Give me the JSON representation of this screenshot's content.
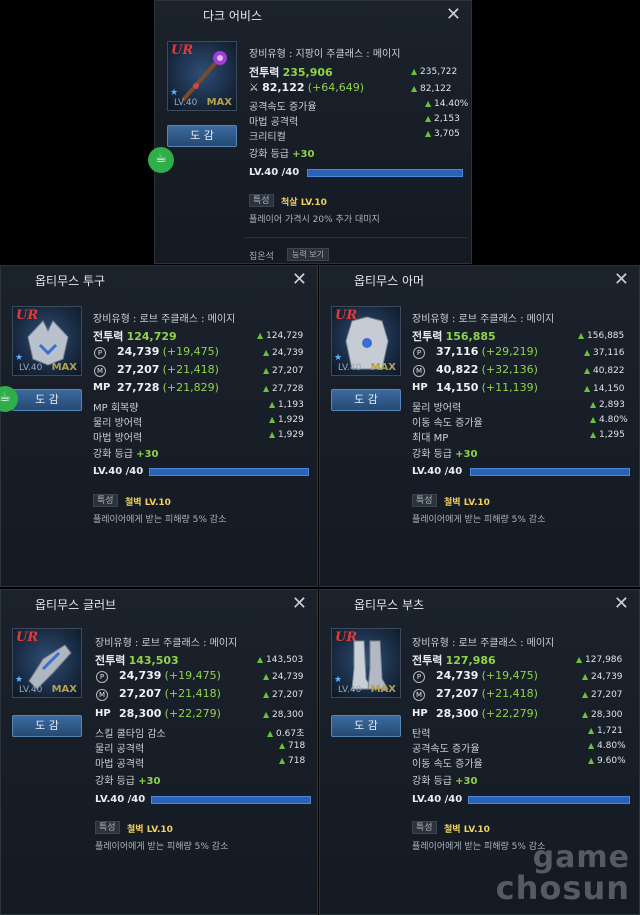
{
  "common": {
    "dogam": "도 감",
    "lv_small": "LV.40",
    "max": "MAX",
    "lvbar": "LV.40 /40",
    "trait": "특성",
    "plus30": "+30",
    "enh_label": "강화 등급",
    "cp_label": "전투력",
    "ur": "UR"
  },
  "abyss": {
    "title": "다크 어비스",
    "type_line": "장비유형 : 지팡이  주클래스 : 메이지",
    "cp": "235,906",
    "cp_r": "235,722",
    "atk": "82,122",
    "atk_gain": "(+64,649)",
    "atk_r": "82,122",
    "s1": "공격속도 증가율",
    "s1v": "14.40%",
    "s2": "마법 공격력",
    "s2v": "2,153",
    "s3": "크리티컬",
    "s3v": "3,705",
    "trait_v": "척살 LV.10",
    "desc": "플레이어 가격시 20% 추가 대미지",
    "jipon": "집온석",
    "ability": "능력 보기"
  },
  "helm": {
    "title": "옵티무스 투구",
    "type_line": "장비유형 : 로브     주클래스 : 메이지",
    "cp": "124,729",
    "cp_r": "124,729",
    "p": "24,739",
    "p_gain": "(+19,475)",
    "p_r": "24,739",
    "m": "27,207",
    "m_gain": "(+21,418)",
    "m_r": "27,207",
    "x_lbl": "MP",
    "x": "27,728",
    "x_gain": "(+21,829)",
    "x_r": "27,728",
    "s1": "MP 회복량",
    "s1v": "1,193",
    "s2": "물리 방어력",
    "s2v": "1,929",
    "s3": "마법 방어력",
    "s3v": "1,929",
    "trait_v": "철벽 LV.10",
    "desc": "플레이어에게 받는 피해량 5% 감소"
  },
  "armor": {
    "title": "옵티무스 아머",
    "type_line": "장비유형 : 로브     주클래스 : 메이지",
    "cp": "156,885",
    "cp_r": "156,885",
    "p": "37,116",
    "p_gain": "(+29,219)",
    "p_r": "37,116",
    "m": "40,822",
    "m_gain": "(+32,136)",
    "m_r": "40,822",
    "x_lbl": "HP",
    "x": "14,150",
    "x_gain": "(+11,139)",
    "x_r": "14,150",
    "s1": "물리 방어력",
    "s1v": "2,893",
    "s2": "이동 속도 증가율",
    "s2v": "4.80%",
    "s3": "최대 MP",
    "s3v": "1,295",
    "trait_v": "철벽 LV.10",
    "desc": "플레이어에게 받는 피해량 5% 감소"
  },
  "glove": {
    "title": "옵티무스 글러브",
    "type_line": "장비유형 : 로브     주클래스 : 메이지",
    "cp": "143,503",
    "cp_r": "143,503",
    "p": "24,739",
    "p_gain": "(+19,475)",
    "p_r": "24,739",
    "m": "27,207",
    "m_gain": "(+21,418)",
    "m_r": "27,207",
    "x_lbl": "HP",
    "x": "28,300",
    "x_gain": "(+22,279)",
    "x_r": "28,300",
    "s1": "스킬 쿨타임 감소",
    "s1v": "0.67초",
    "s2": "물리 공격력",
    "s2v": "718",
    "s3": "마법 공격력",
    "s3v": "718",
    "trait_v": "철벽 LV.10",
    "desc": "플레이어에게 받는 피해량 5% 감소"
  },
  "boots": {
    "title": "옵티무스 부츠",
    "type_line": "장비유형 : 로브     주클래스 : 메이지",
    "cp": "127,986",
    "cp_r": "127,986",
    "p": "24,739",
    "p_gain": "(+19,475)",
    "p_r": "24,739",
    "m": "27,207",
    "m_gain": "(+21,418)",
    "m_r": "27,207",
    "x_lbl": "HP",
    "x": "28,300",
    "x_gain": "(+22,279)",
    "x_r": "28,300",
    "s1": "탄력",
    "s1v": "1,721",
    "s2": "공격속도 증가율",
    "s2v": "4.80%",
    "s3": "이동 속도 증가율",
    "s3v": "9.60%",
    "trait_v": "철벽 LV.10",
    "desc": "플레이어에게 받는 피해량 5% 감소"
  },
  "watermark": {
    "line1": "game",
    "line2": "chosun"
  }
}
